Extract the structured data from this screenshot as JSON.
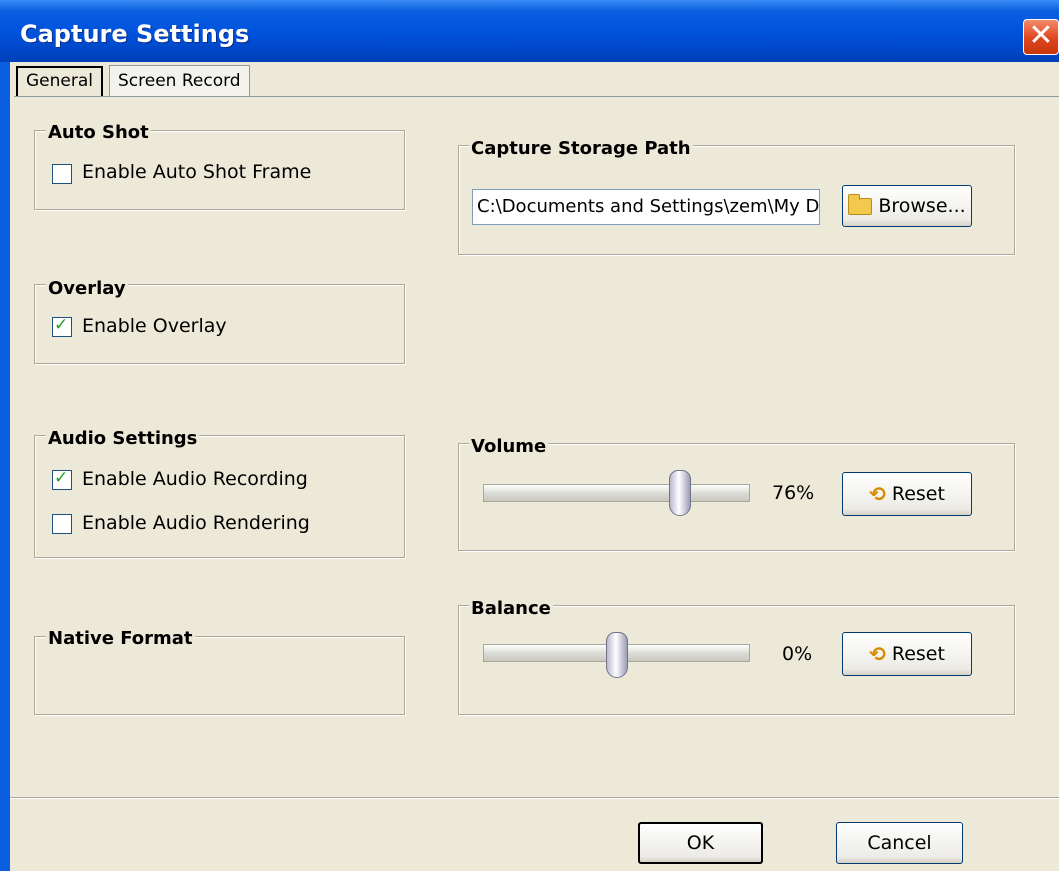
{
  "window": {
    "title": "Capture Settings",
    "close_glyph": "✕"
  },
  "tabs": [
    {
      "label": "General",
      "active": true
    },
    {
      "label": "Screen Record",
      "active": false
    }
  ],
  "auto_shot": {
    "legend": "Auto Shot",
    "enable_label": "Enable Auto Shot Frame",
    "checked": false
  },
  "overlay": {
    "legend": "Overlay",
    "enable_label": "Enable Overlay",
    "checked": true
  },
  "audio": {
    "legend": "Audio Settings",
    "recording_label": "Enable Audio Recording",
    "recording_checked": true,
    "rendering_label": "Enable Audio Rendering",
    "rendering_checked": false
  },
  "native_format": {
    "legend": "Native Format"
  },
  "storage": {
    "legend": "Capture Storage Path",
    "path_value": "C:\\Documents and Settings\\zem\\My D",
    "browse_label": "Browse...",
    "browse_icon": "folder-icon"
  },
  "volume": {
    "legend": "Volume",
    "value_text": "76%",
    "level": 0.76,
    "reset_label": "Reset",
    "reset_icon": "reset-icon"
  },
  "balance": {
    "legend": "Balance",
    "value_text": "0%",
    "level": 0.5,
    "reset_label": "Reset",
    "reset_icon": "reset-icon"
  },
  "footer": {
    "ok_label": "OK",
    "cancel_label": "Cancel"
  },
  "colors": {
    "title_bar": "#0053dd",
    "dialog_bg": "#ece9d8",
    "close_button": "#e0451d"
  }
}
